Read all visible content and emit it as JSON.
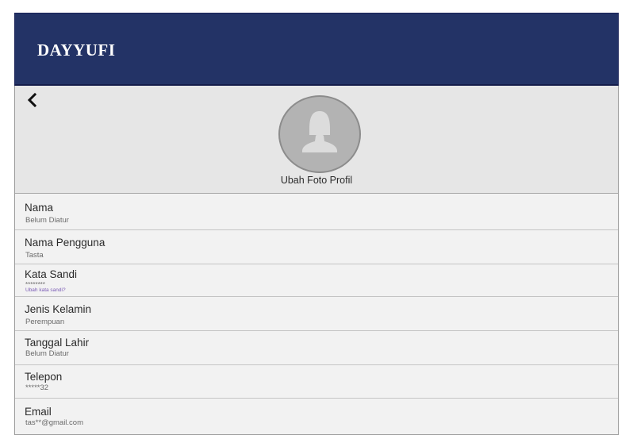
{
  "header": {
    "brand": "DAYYUFI"
  },
  "profile": {
    "change_photo_label": "Ubah Foto Profil"
  },
  "fields": [
    {
      "label": "Nama",
      "value": "Belum Diatur"
    },
    {
      "label": "Nama Pengguna",
      "value": "Tasta"
    },
    {
      "label": "Kata Sandi",
      "value": "********",
      "link": "Ubah kata sandi?"
    },
    {
      "label": "Jenis Kelamin",
      "value": "Perempuan"
    },
    {
      "label": "Tanggal Lahir",
      "value": "Belum Diatur"
    },
    {
      "label": "Telepon",
      "value": "*****32"
    },
    {
      "label": "Email",
      "value": "tas**@gmail.com"
    }
  ],
  "colors": {
    "header_bg": "#233366",
    "link": "#7a5bb5"
  },
  "icons": {
    "back": "chevron-left-icon",
    "avatar": "user-silhouette-icon"
  }
}
